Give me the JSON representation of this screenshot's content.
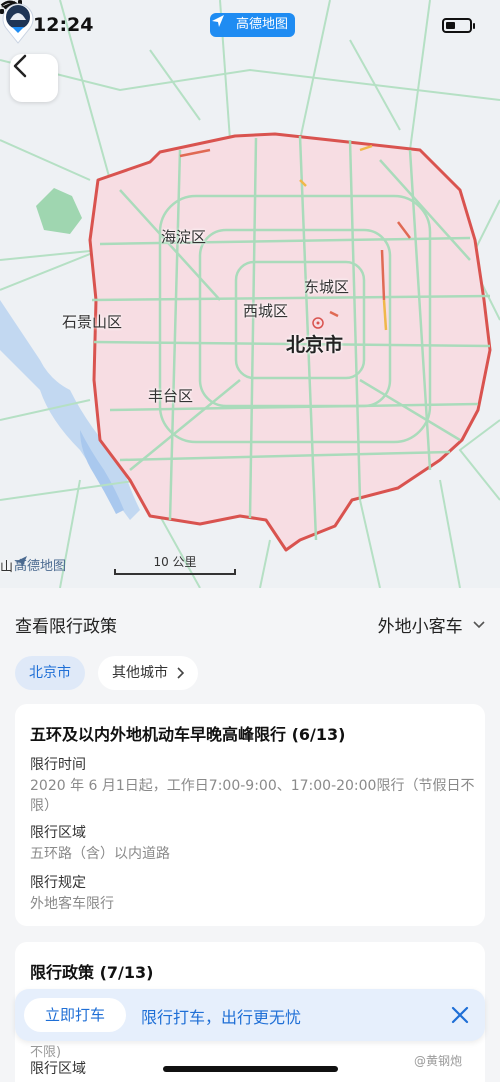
{
  "status": {
    "time": "12:24",
    "app_badge": "高德地图"
  },
  "colors": {
    "accent": "#1f6fd6",
    "ring_road": "#d9534f",
    "zone_fill": "#f7dde3",
    "roads": "#9fdbb4"
  },
  "map": {
    "labels": {
      "haidian": "海淀区",
      "dongcheng": "东城区",
      "shijingshan": "石景山区",
      "xicheng": "西城区",
      "beijing": "北京市",
      "fengtai": "丰台区",
      "shan": "山"
    },
    "logo": "高德地图",
    "scale": "10 公里",
    "icons": {
      "back": "chevron-left-icon",
      "marker": "car-location-icon"
    }
  },
  "panel": {
    "title": "查看限行政策",
    "vehicle_type": "外地小客车",
    "chips": {
      "active": "北京市",
      "other": "其他城市"
    }
  },
  "card1": {
    "title": "五环及以内外地机动车早晚高峰限行 (6/13)",
    "time_label": "限行时间",
    "time_value": "2020 年 6 月1日起，工作日7:00-9:00、17:00-20:00限行（节假日不限）",
    "area_label": "限行区域",
    "area_value": "五环路（含）以内道路",
    "rule_label": "限行规定",
    "rule_value": "外地客车限行"
  },
  "card2": {
    "title": "限行政策 (7/13)"
  },
  "promo": {
    "button": "立即打车",
    "text": "限行打车，出行更无忧"
  },
  "peek": {
    "text": "不限)",
    "label": "限行区域"
  },
  "watermark": "@黄钢炮"
}
